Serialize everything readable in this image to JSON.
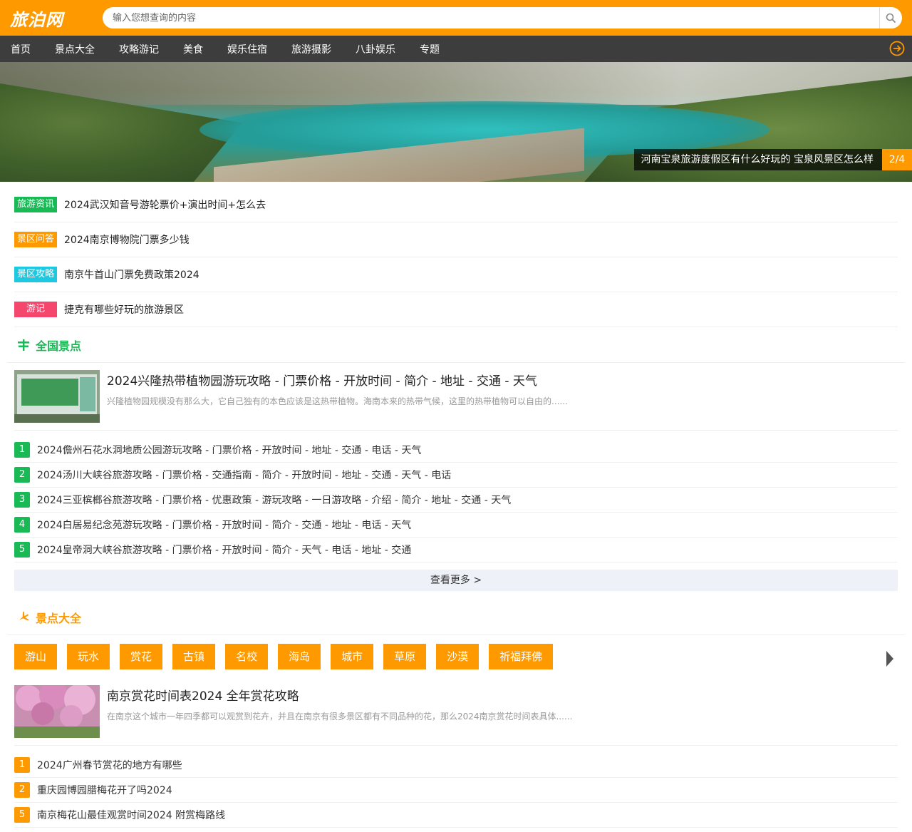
{
  "header": {
    "logo": "旅泊网",
    "search_placeholder": "输入您想查询的内容",
    "bg_color": "#ff9900"
  },
  "nav": {
    "items": [
      "首页",
      "景点大全",
      "攻略游记",
      "美食",
      "娱乐住宿",
      "旅游摄影",
      "八卦娱乐",
      "专题"
    ],
    "more_icon": "arrow-right-circle-icon"
  },
  "banner": {
    "caption": "河南宝泉旅游度假区有什么好玩的 宝泉风景区怎么样",
    "index": "2/4"
  },
  "news": [
    {
      "tag": "旅游资讯",
      "tag_color": "#19b955",
      "title": "2024武汉知音号游轮票价+演出时间+怎么去"
    },
    {
      "tag": "景区问答",
      "tag_color": "#ff9900",
      "title": "2024南京博物院门票多少钱"
    },
    {
      "tag": "景区攻略",
      "tag_color": "#1ec8e0",
      "title": "南京牛首山门票免费政策2024"
    },
    {
      "tag": "游记",
      "tag_color": "#f5476e",
      "title": "捷克有哪些好玩的旅游景区"
    }
  ],
  "section1": {
    "title": "全国景点",
    "color": "#19b955",
    "icon": "signpost-icon",
    "feature": {
      "title": "2024兴隆热带植物园游玩攻略 - 门票价格 - 开放时间 - 简介 - 地址 - 交通 - 天气",
      "desc": "兴隆植物园规模没有那么大，它自己独有的本色应该是这热带植物。海南本来的热带气候，这里的热带植物可以自由的......"
    },
    "list": [
      {
        "num": "1",
        "title": "2024儋州石花水洞地质公园游玩攻略 - 门票价格 - 开放时间 - 地址 - 交通 - 电话 - 天气"
      },
      {
        "num": "2",
        "title": "2024汤川大峡谷旅游攻略 - 门票价格 - 交通指南 - 简介 - 开放时间 - 地址 - 交通 - 天气 - 电话"
      },
      {
        "num": "3",
        "title": "2024三亚槟榔谷旅游攻略 - 门票价格 - 优惠政策 - 游玩攻略 - 一日游攻略 - 介绍 - 简介 - 地址 - 交通 - 天气"
      },
      {
        "num": "4",
        "title": "2024白居易纪念苑游玩攻略 - 门票价格 - 开放时间 - 简介 - 交通 - 地址 - 电话 - 天气"
      },
      {
        "num": "5",
        "title": "2024皇帝洞大峡谷旅游攻略 - 门票价格 - 开放时间 - 简介 - 天气 - 电话 - 地址 - 交通"
      }
    ],
    "more": "查看更多 >"
  },
  "section2": {
    "title": "景点大全",
    "color": "#ff9900",
    "icon": "airplane-icon",
    "categories": [
      "游山",
      "玩水",
      "赏花",
      "古镇",
      "名校",
      "海岛",
      "城市",
      "草原",
      "沙漠",
      "祈福拜佛"
    ],
    "feature": {
      "title": "南京赏花时间表2024 全年赏花攻略",
      "desc": "在南京这个城市一年四季都可以观赏到花卉，并且在南京有很多景区都有不同品种的花，那么2024南京赏花时间表具体......"
    },
    "list": [
      {
        "num": "1",
        "title": "2024广州春节赏花的地方有哪些"
      },
      {
        "num": "2",
        "title": "重庆园博园腊梅花开了吗2024"
      },
      {
        "num": "5",
        "title": "南京梅花山最佳观赏时间2024 附赏梅路线"
      }
    ]
  }
}
